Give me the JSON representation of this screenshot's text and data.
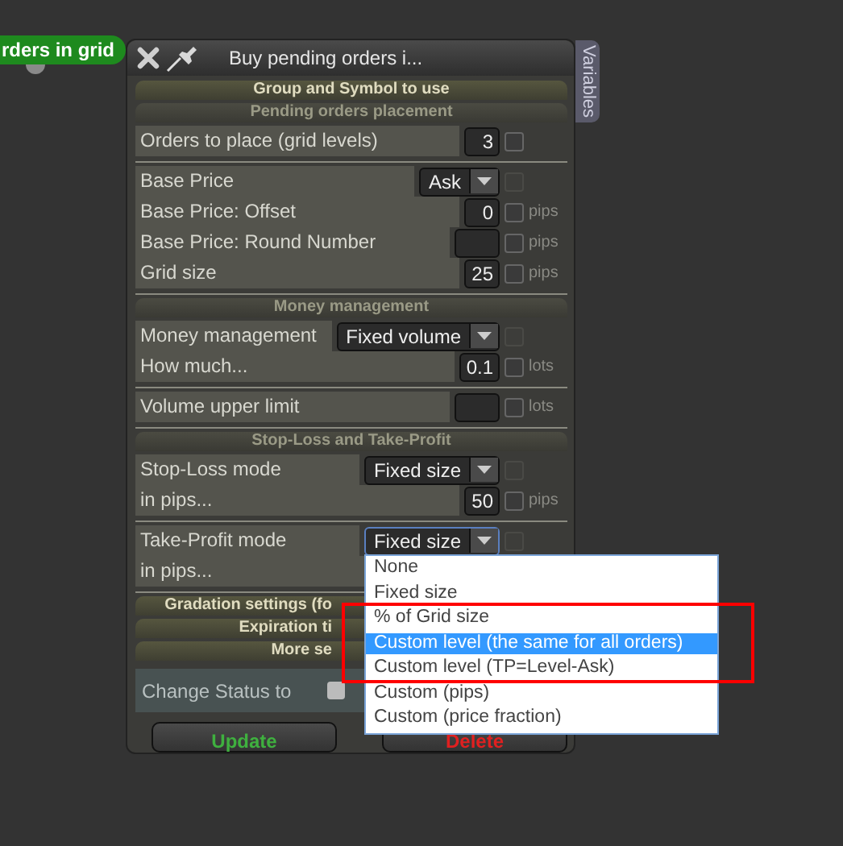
{
  "badge": {
    "label": "rders in grid"
  },
  "window": {
    "title": "Buy pending orders i...",
    "side_tab": "Variables"
  },
  "sections": [
    {
      "label": "Group and Symbol to use",
      "expanded": false
    },
    {
      "label": "Pending orders placement",
      "expanded": true,
      "groups": [
        [
          {
            "label": "Orders to place (grid levels)",
            "kind": "number",
            "value": "3",
            "checked": false,
            "disabled": false
          }
        ],
        [
          {
            "label": "Base Price",
            "kind": "select",
            "value": "Ask",
            "checked": false,
            "disabled": true
          },
          {
            "label": "Base Price: Offset",
            "kind": "number",
            "value": "0",
            "unit": "pips",
            "checked": false,
            "disabled": false
          },
          {
            "label": "Base Price: Round Number",
            "kind": "number",
            "unit": "pips",
            "checked": false,
            "disabled": false
          },
          {
            "label": "Grid size",
            "kind": "number",
            "value": "25",
            "unit": "pips",
            "checked": false,
            "disabled": false
          }
        ]
      ]
    },
    {
      "label": "Money management",
      "expanded": true,
      "groups": [
        [
          {
            "label": "Money management",
            "kind": "select",
            "value": "Fixed volume",
            "checked": false,
            "disabled": true
          },
          {
            "label": "How much...",
            "kind": "number",
            "value": "0.1",
            "unit": "lots",
            "checked": false,
            "disabled": false
          }
        ],
        [
          {
            "label": "Volume upper limit",
            "kind": "number",
            "unit": "lots",
            "checked": false,
            "disabled": false
          }
        ]
      ]
    },
    {
      "label": "Stop-Loss and Take-Profit",
      "expanded": true,
      "groups": [
        [
          {
            "label": "Stop-Loss mode",
            "kind": "select",
            "value": "Fixed size",
            "checked": false,
            "disabled": true
          },
          {
            "label": "in pips...",
            "kind": "number",
            "value": "50",
            "unit": "pips",
            "checked": false,
            "disabled": false
          }
        ],
        [
          {
            "label": "Take-Profit mode",
            "kind": "select",
            "value": "Fixed size",
            "focused": true,
            "checked": false,
            "disabled": true
          },
          {
            "label": "in pips...",
            "kind": "blank"
          }
        ]
      ]
    },
    {
      "label": "Gradation settings (fo",
      "expanded": false
    },
    {
      "label": "Expiration ti",
      "expanded": false
    },
    {
      "label": "More se",
      "expanded": false
    }
  ],
  "status_row": {
    "label": "Change Status to",
    "checked": false
  },
  "buttons": [
    {
      "label": "Update",
      "kind": "ok"
    },
    {
      "label": "Delete",
      "kind": "danger"
    }
  ],
  "dropdown": {
    "options": [
      {
        "label": "None",
        "selected": false
      },
      {
        "label": "Fixed size",
        "selected": false
      },
      {
        "label": "% of Grid size",
        "selected": false
      },
      {
        "label": "Custom level (the same for all orders)",
        "selected": true
      },
      {
        "label": "Custom level (TP=Level-Ask)",
        "selected": false
      },
      {
        "label": "Custom (pips)",
        "selected": false
      },
      {
        "label": "Custom (price fraction)",
        "selected": false
      }
    ]
  }
}
